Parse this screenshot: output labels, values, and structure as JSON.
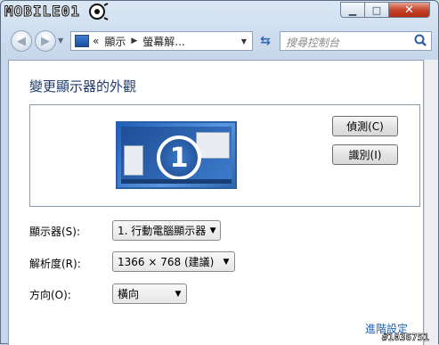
{
  "watermark": {
    "brand": "MOBILE01",
    "id": "#1036751"
  },
  "titlebar": {
    "minimize_icon": "minimize-icon",
    "maximize_icon": "maximize-icon",
    "close_icon": "close-icon"
  },
  "nav": {
    "back_icon": "back-arrow-icon",
    "forward_icon": "forward-arrow-icon"
  },
  "address": {
    "prefix": "«",
    "crumbs": [
      "顯示",
      "螢幕解..."
    ]
  },
  "search": {
    "placeholder": "搜尋控制台"
  },
  "page": {
    "title": "變更顯示器的外觀",
    "monitor_number": "1",
    "detect_label": "偵測(C)",
    "identify_label": "識別(I)"
  },
  "settings": {
    "display_label": "顯示器(S):",
    "display_value": "1. 行動電腦顯示器",
    "resolution_label": "解析度(R):",
    "resolution_value": "1366 × 768 (建議)",
    "orientation_label": "方向(O):",
    "orientation_value": "橫向"
  },
  "links": {
    "advanced": "進階設定"
  },
  "colors": {
    "accent_link": "#1a5fb4",
    "title_text": "#1e3a6b",
    "close_button": "#c6452c"
  }
}
